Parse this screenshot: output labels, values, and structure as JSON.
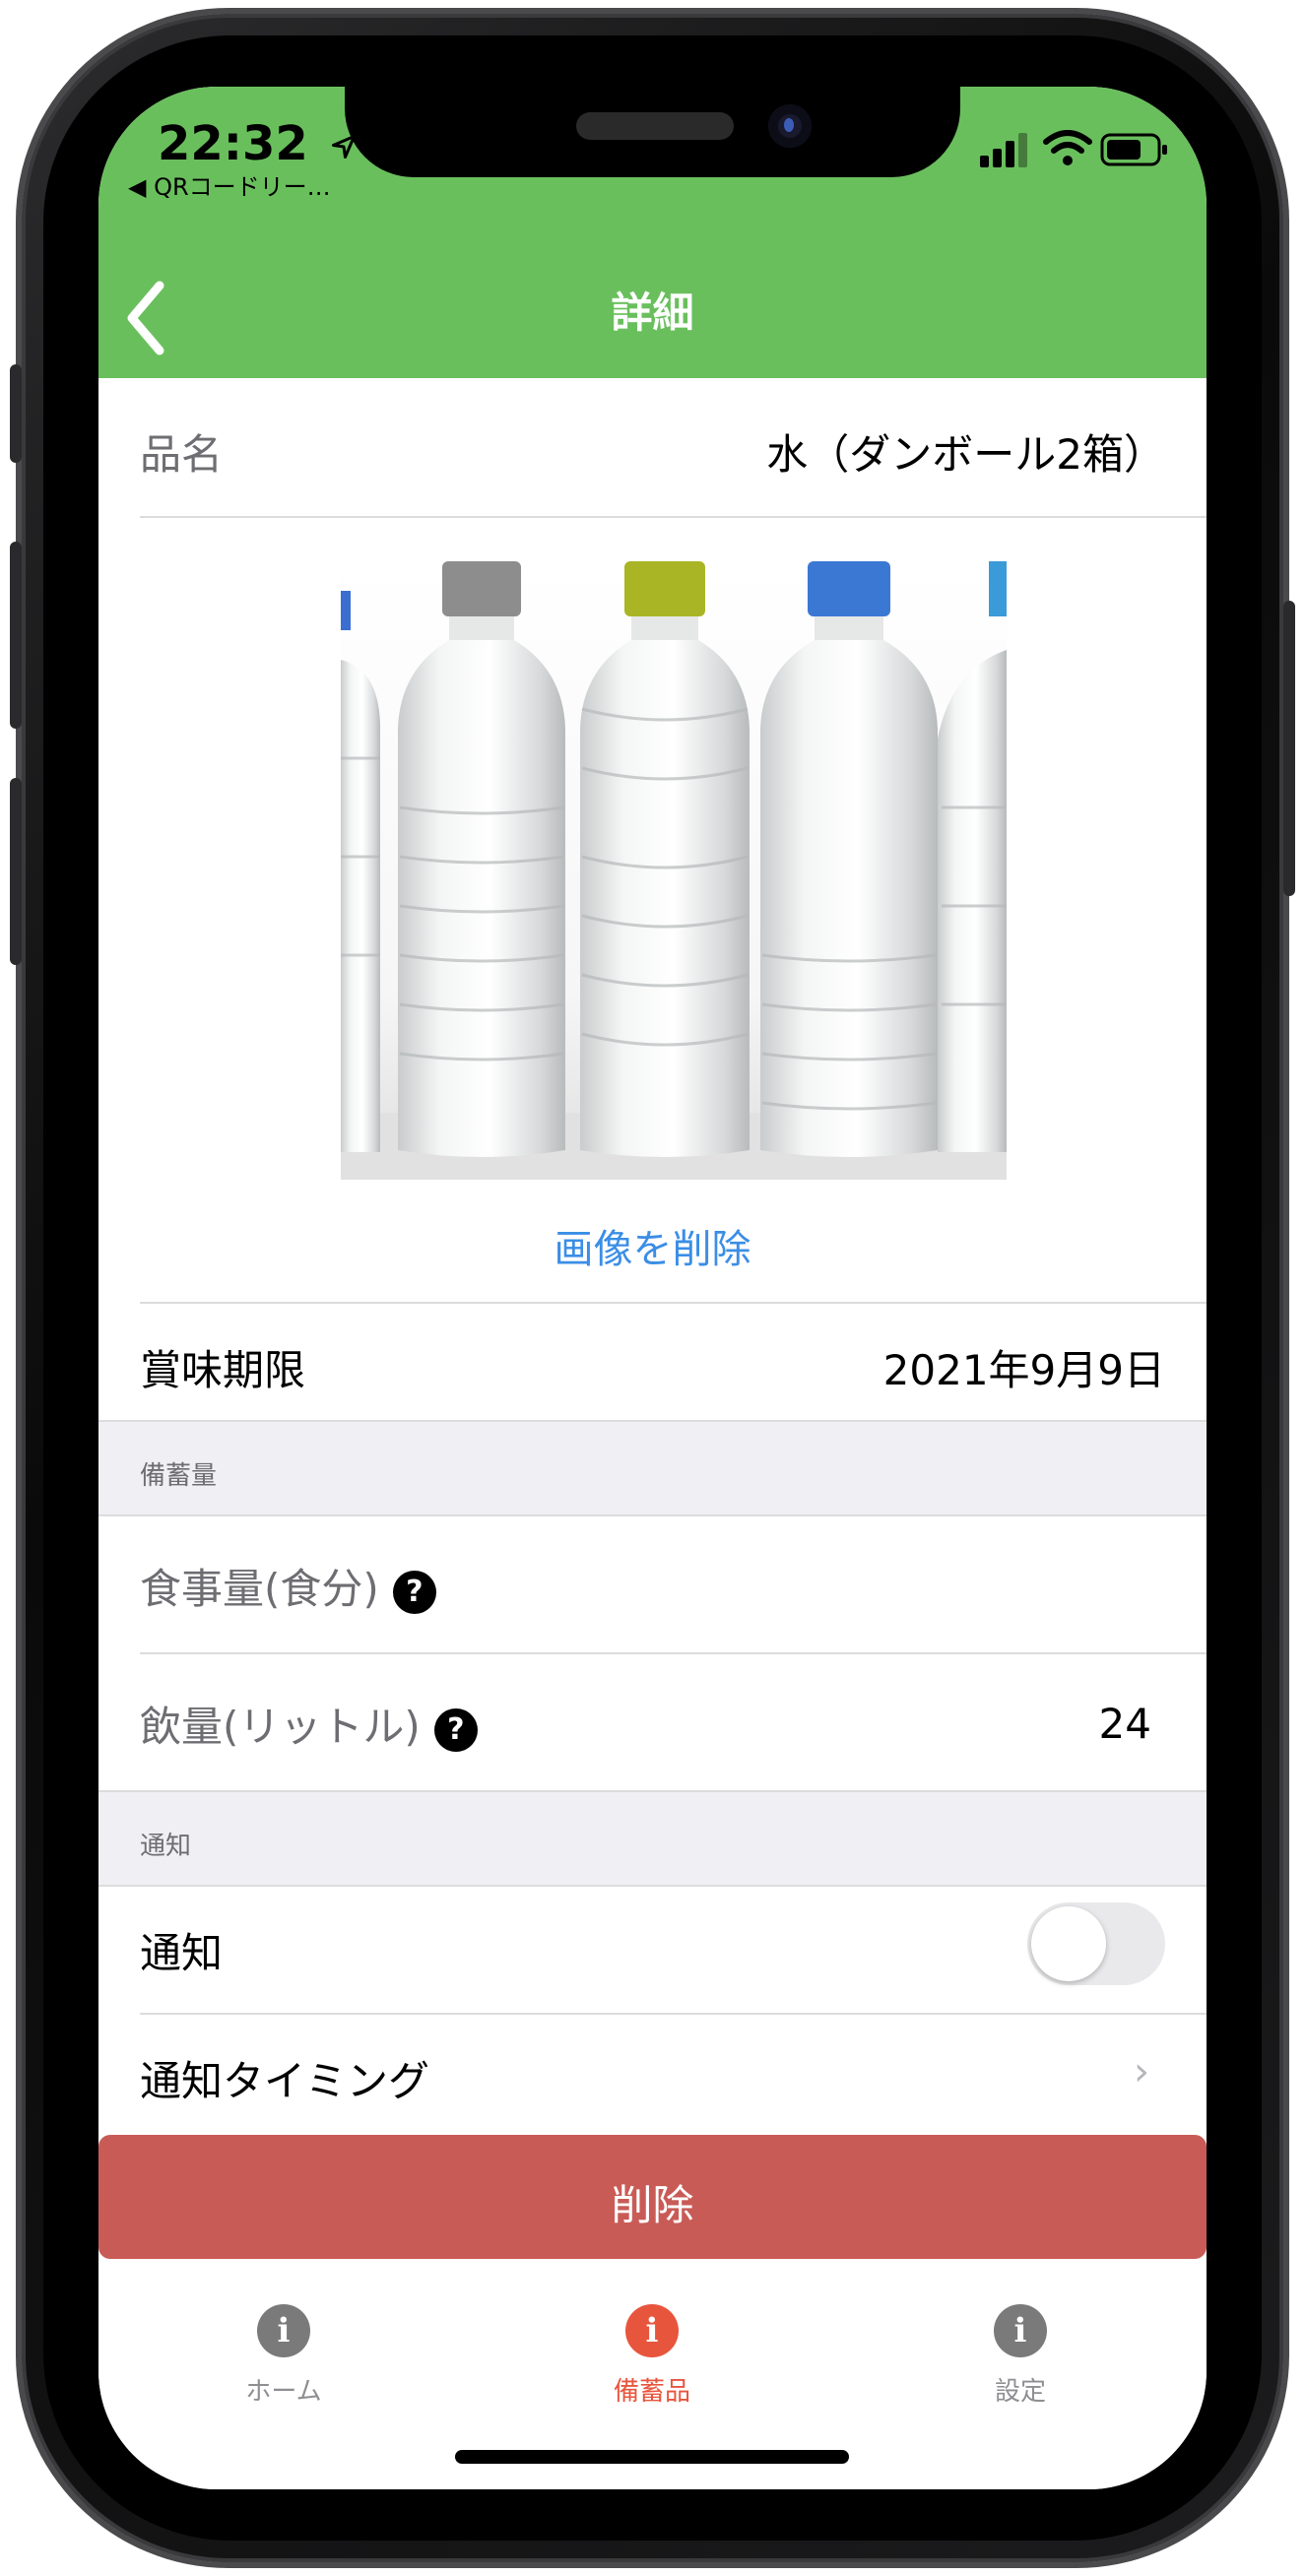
{
  "status_bar": {
    "time": "22:32",
    "back_app": "◀ QRコードリー…"
  },
  "nav": {
    "title": "詳細"
  },
  "product": {
    "name_label": "品名",
    "name_value": "水（ダンボール2箱）"
  },
  "image": {
    "delete_label": "画像を削除"
  },
  "expiry": {
    "label": "賞味期限",
    "value": "2021年9月9日"
  },
  "stock_section": {
    "header": "備蓄量",
    "meals_label": "食事量(食分)",
    "meals_value": "",
    "drink_label": "飲量(リットル)",
    "drink_value": "24",
    "help_glyph": "?"
  },
  "notify_section": {
    "header": "通知",
    "notify_label": "通知",
    "notify_enabled": false,
    "timing_label": "通知タイミング",
    "chevron": "›"
  },
  "actions": {
    "delete_label": "削除"
  },
  "tabbar": {
    "tabs": [
      {
        "label": "ホーム",
        "icon": "info-icon",
        "glyph": "i",
        "active": false
      },
      {
        "label": "備蓄品",
        "icon": "info-icon",
        "glyph": "i",
        "active": true
      },
      {
        "label": "設定",
        "icon": "info-icon",
        "glyph": "i",
        "active": false
      }
    ]
  },
  "colors": {
    "header_green": "#6abf5d",
    "link_blue": "#3b8ee6",
    "delete_red": "#c95b56",
    "active_tab": "#e8553d",
    "inactive_tab": "#7a7a7a"
  }
}
